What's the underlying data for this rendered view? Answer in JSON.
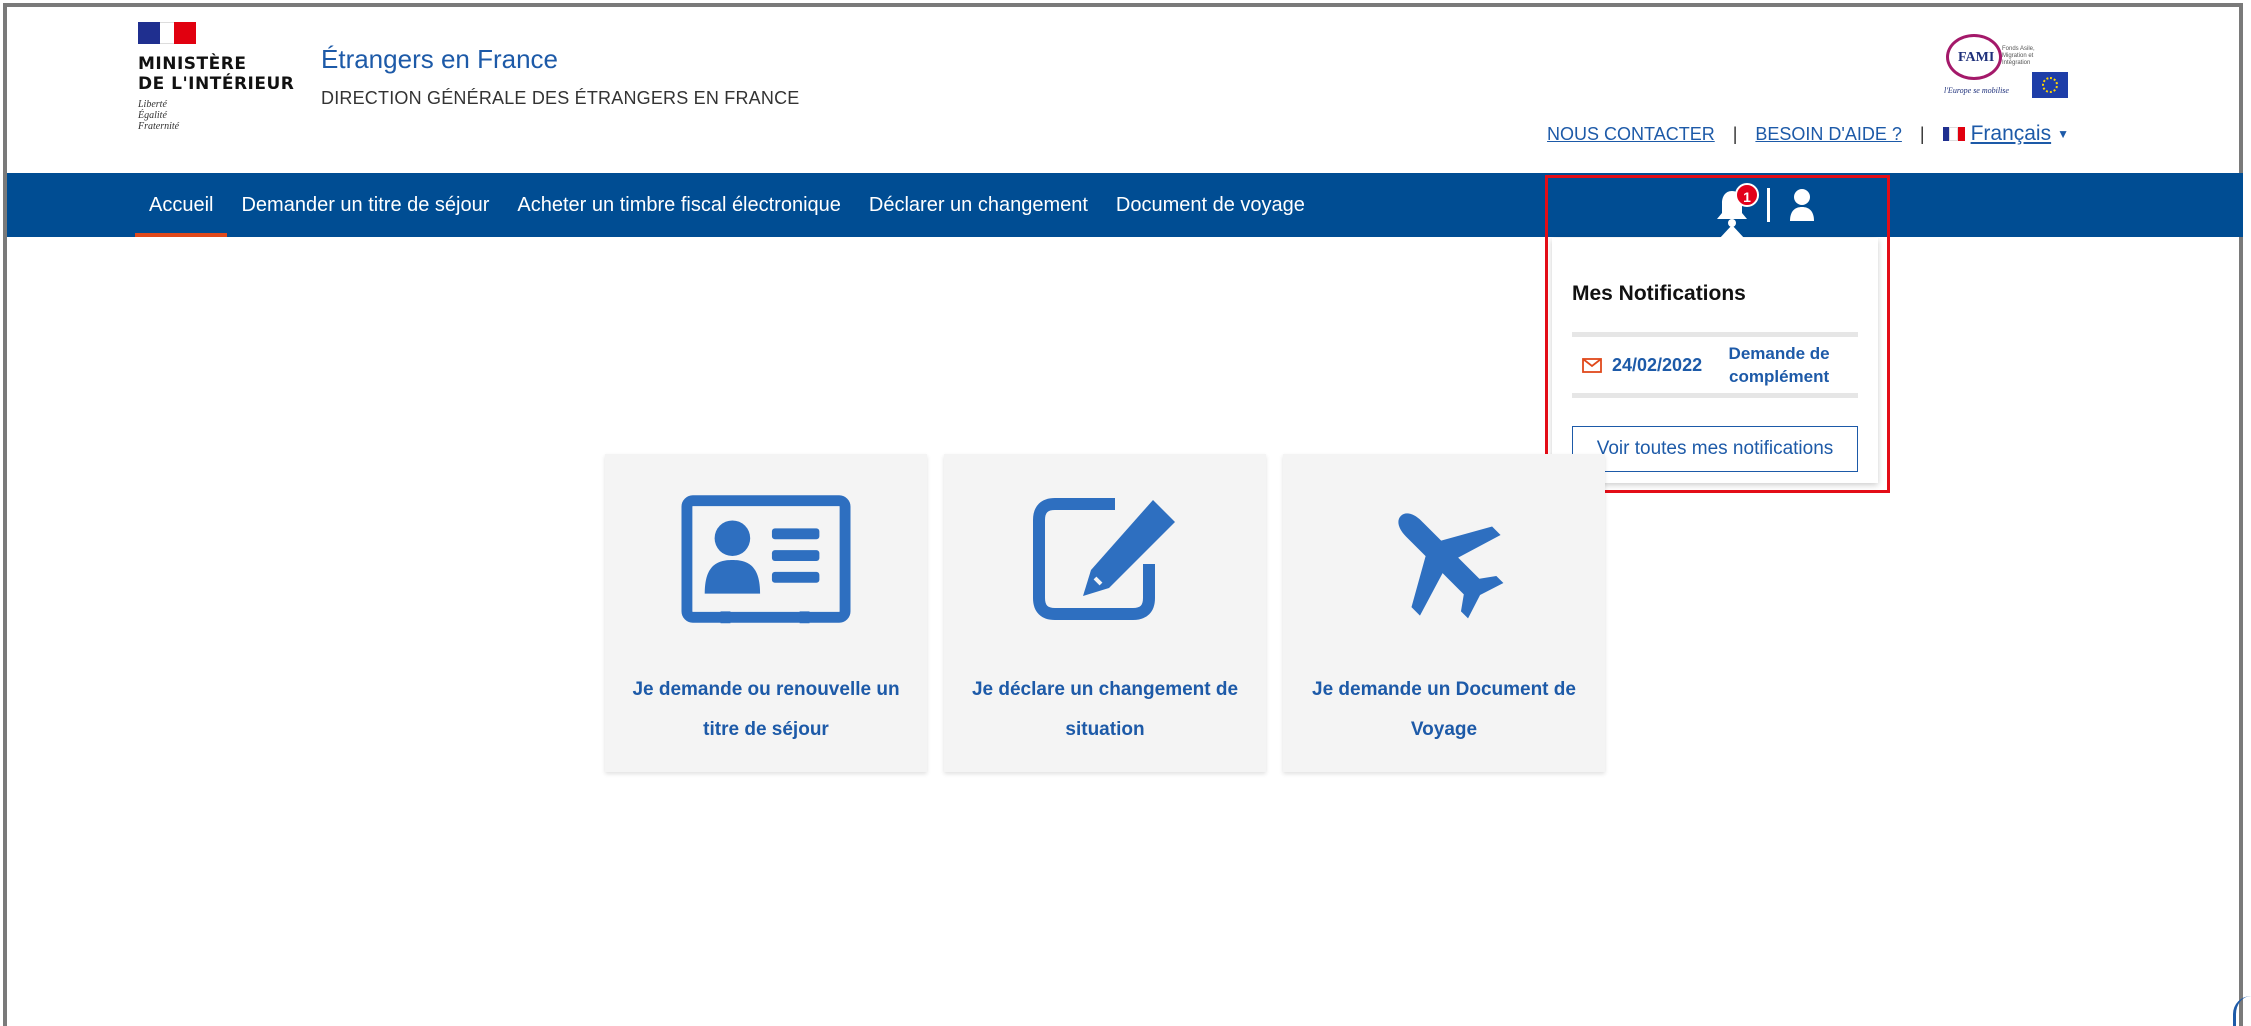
{
  "header": {
    "ministry": "MINISTÈRE\nDE L'INTÉRIEUR",
    "motto": "Liberté\nÉgalité\nFraternité",
    "site_title": "Étrangers en France",
    "site_subtitle": "DIRECTION GÉNÉRALE DES ÉTRANGERS EN FRANCE",
    "fami": {
      "name": "FAMI",
      "small_text": "Fonds Asile,\nMigration et Intégration",
      "tagline": "l'Europe se mobilise"
    },
    "links": {
      "contact": "NOUS CONTACTER",
      "help": "BESOIN D'AIDE ?",
      "separator": "|",
      "language": "Français"
    }
  },
  "nav": {
    "items": [
      {
        "label": "Accueil",
        "active": true
      },
      {
        "label": "Demander un titre de séjour"
      },
      {
        "label": "Acheter un timbre fiscal électronique"
      },
      {
        "label": "Déclarer un changement"
      },
      {
        "label": "Document de voyage"
      }
    ],
    "notification_count": "1"
  },
  "notifications": {
    "title": "Mes Notifications",
    "items": [
      {
        "date": "24/02/2022",
        "type": "Demande de\ncomplément"
      }
    ],
    "view_all": "Voir toutes mes notifications"
  },
  "tiles": [
    {
      "icon": "id-card-icon",
      "label": "Je demande ou renouvelle un titre de séjour"
    },
    {
      "icon": "edit-icon",
      "label": "Je déclare un changement de situation"
    },
    {
      "icon": "plane-icon",
      "label": "Je demande un Document de Voyage"
    }
  ],
  "colors": {
    "primary_blue": "#004d93",
    "link_blue": "#1d5aa8",
    "active_underline": "#e0491b",
    "badge_red": "#e2001a",
    "highlight_red": "#e30d17",
    "tile_bg": "#f4f4f4"
  }
}
